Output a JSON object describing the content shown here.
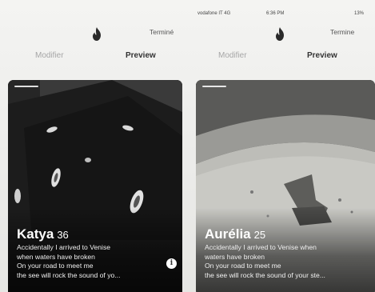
{
  "left": {
    "done_label": "Terminé",
    "tabs": {
      "modifier": "Modifier",
      "preview": "Preview"
    },
    "profile": {
      "name": "Katya",
      "age": "36",
      "bio_lines": [
        "Accidentally I arrived to Venise",
        "when waters have broken",
        "On your road to meet me",
        "the see will rock the sound of yo..."
      ]
    },
    "info_icon": "i"
  },
  "right": {
    "status_bar": {
      "carrier": "vodafone IT 4G",
      "time": "6:36 PM",
      "battery": "13%"
    },
    "done_label": "Termine",
    "tabs": {
      "modifier": "Modifier",
      "preview": "Preview"
    },
    "profile": {
      "name": "Aurélia",
      "age": "25",
      "bio_lines": [
        "Accidentally I arrived to Venise when",
        "waters have broken",
        "On your road to meet me",
        "the see will rock the sound of your ste..."
      ]
    }
  },
  "icons": [
    "tinder-flame-icon",
    "info-icon",
    "signal-icon",
    "battery-icon"
  ],
  "colors": {
    "flame": "#2a2a2a",
    "card_dark": "#1f1f1f",
    "tab_inactive": "#a6a6a6"
  }
}
